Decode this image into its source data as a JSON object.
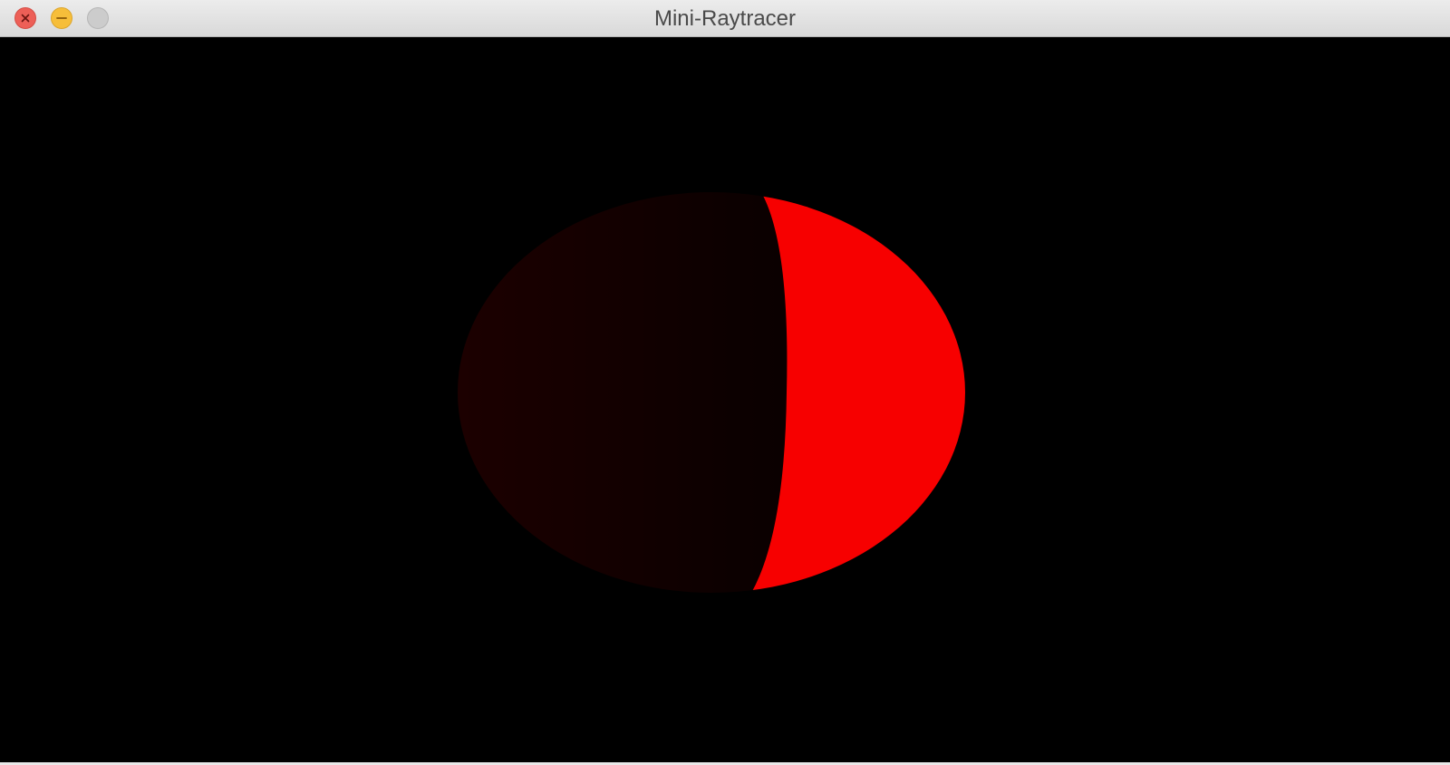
{
  "window": {
    "title": "Mini-Raytracer"
  },
  "controls": {
    "close_icon": "close-x-icon",
    "minimize_icon": "minimize-dash-icon",
    "zoom_icon": "zoom-icon"
  },
  "scene": {
    "background_color": "#000000",
    "sphere_lit_color": "#ff0000",
    "sphere_shadow_color": "#1a0000"
  }
}
